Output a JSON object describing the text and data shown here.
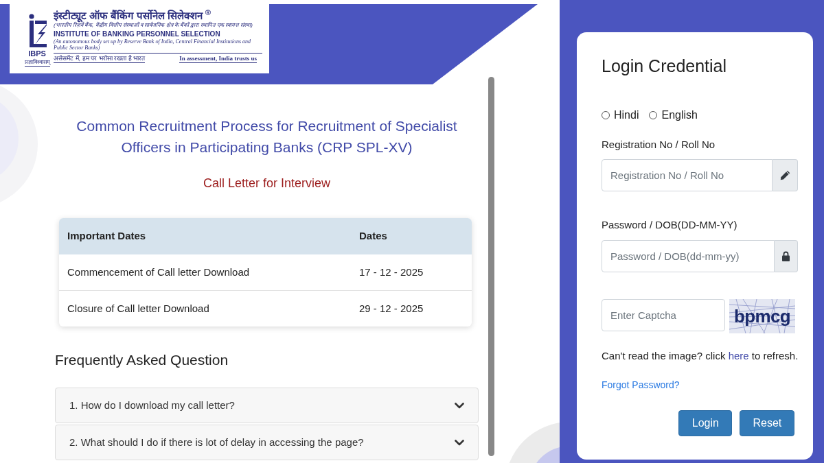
{
  "logo": {
    "hindi_title": "इंस्टीट्यूट ऑफ बैंकिंग पर्सोनेल सिलेक्शन $^{®}$",
    "hindi_subtitle": "(भारतीय रिज़र्व बैंक, केंद्रीय वित्तीय संस्थाओं व सार्वजनिक क्षेत्र के बैंकों द्वारा स्थापित एक स्वायत्त संस्था)",
    "title": "INSTITUTE OF BANKING PERSONNEL SELECTION",
    "subtitle": "(An autonomous body set up by Reserve Bank of India, Central Financial Institutions and Public Sector Banks)",
    "abbreviation": "IBPS",
    "hindi_motto": "प्रज्ञाविश्वासम्",
    "hindi_tagline": "असेसमेंट में, हम पर भरोसा रखता है भारत",
    "tagline": "In assessment, India trusts us"
  },
  "heading": "Common Recruitment Process for Recruitment of Specialist Officers in Participating Banks (CRP SPL-XV)",
  "subheading": "Call Letter for Interview",
  "dates_table": {
    "columns": [
      "Important Dates",
      "Dates"
    ],
    "rows": [
      [
        "Commencement of Call letter Download",
        "17 - 12 - 2025"
      ],
      [
        "Closure of Call letter Download",
        "29 - 12 - 2025"
      ]
    ]
  },
  "faq": {
    "title": "Frequently Asked Question",
    "items": [
      {
        "question": "1. How do I download my call letter?",
        "expanded": false
      },
      {
        "question": "2. What should I do if there is lot of delay in accessing the page?",
        "expanded": false
      }
    ]
  },
  "login": {
    "title": "Login Credential",
    "languages": [
      {
        "label": "Hindi",
        "selected": false
      },
      {
        "label": "English",
        "selected": false
      }
    ],
    "fields": [
      {
        "kind": "text",
        "label": "Registration No / Roll No",
        "placeholder": "Registration No / Roll No"
      },
      {
        "kind": "password",
        "label": "Password / DOB(DD-MM-YY)",
        "placeholder": "Password / DOB(dd-mm-yy)"
      }
    ],
    "captcha": {
      "placeholder": "Enter Captcha",
      "image_text": "bpmcg"
    },
    "refresh_hint": {
      "before": "Can't read the image? click ",
      "link": "here",
      "after": " to refresh."
    },
    "forgot_password": "Forgot Password?",
    "buttons": [
      "Login",
      "Reset"
    ]
  }
}
